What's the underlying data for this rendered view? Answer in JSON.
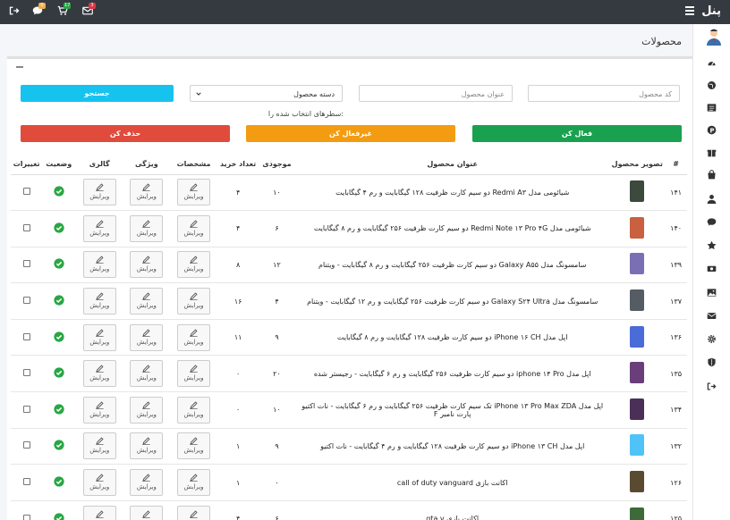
{
  "topbar": {
    "brand": "پنل",
    "badges": {
      "chat": "0",
      "cart": "17",
      "mail": "3"
    },
    "colors": {
      "chat": "#f0ad4e",
      "cart": "#28a745",
      "mail": "#dc3545"
    }
  },
  "page": {
    "title": "محصولات"
  },
  "filters": {
    "code_placeholder": "کد محصول",
    "title_placeholder": "عنوان محصول",
    "category_value": "دسته محصول",
    "search_label": "جستجو"
  },
  "bulk": {
    "note": "سطرهای انتخاب شده را:",
    "activate": "فعال کن",
    "deactivate": "غیرفعال کن",
    "delete": "حذف کن"
  },
  "table": {
    "headers": {
      "num": "#",
      "image": "تصویر محصول",
      "title": "عنوان محصول",
      "stock": "موجودی",
      "sold": "تعداد خرید",
      "specs": "مشخصات",
      "features": "ویژگی",
      "gallery": "گالری",
      "status": "وضعیت",
      "changes": "تغییرات"
    },
    "edit_label": "ویرایش",
    "rows": [
      {
        "num": "۱۴۱",
        "title": "شیائومی مدل Redmi A۳ دو سیم کارت ظرفیت ۱۲۸ گیگابایت و رم ۴ گیگابایت",
        "stock": "۱۰",
        "sold": "۴"
      },
      {
        "num": "۱۴۰",
        "title": "شیائومی مدل Redmi Note ۱۳ Pro ۴G دو سیم کارت ظرفیت ۲۵۶ گیگابایت و رم ۸ گیگابایت",
        "stock": "۶",
        "sold": "۴"
      },
      {
        "num": "۱۳۹",
        "title": "سامسونگ مدل Galaxy A۵۵ دو سیم کارت ظرفیت ۲۵۶ گیگابایت و رم ۸ گیگابایت - ویتنام",
        "stock": "۱۲",
        "sold": "۸"
      },
      {
        "num": "۱۳۷",
        "title": "سامسونگ مدل Galaxy S۲۴ Ultra دو سیم کارت ظرفیت ۲۵۶ گیگابایت و رم ۱۲ گیگابایت - ویتنام",
        "stock": "۴",
        "sold": "۱۶"
      },
      {
        "num": "۱۳۶",
        "title": "اپل مدل iPhone ۱۶ CH دو سیم کارت ظرفیت ۱۲۸ گیگابایت و رم ۸ گیگابایت",
        "stock": "۹",
        "sold": "۱۱"
      },
      {
        "num": "۱۳۵",
        "title": "اپل مدل iphone ۱۴ Pro دو سیم کارت ظرفیت ۲۵۶ گیگابایت و رم ۶ گیگابایت - رجیستر شده",
        "stock": "۲۰",
        "sold": "۰"
      },
      {
        "num": "۱۳۴",
        "title": "اپل مدل iPhone ۱۳ Pro Max ZDA تک سیم کارت ظرفیت ۲۵۶ گیگابایت و رم ۶ گیگابایت - نات اکتیو پارت نامبر F",
        "stock": "۱۰",
        "sold": "۰"
      },
      {
        "num": "۱۳۲",
        "title": "اپل مدل iPhone ۱۳ CH دو سیم کارت ظرفیت ۱۲۸ گیگابایت و رم ۴ گیگابایت - نات اکتیو",
        "stock": "۹",
        "sold": "۱"
      },
      {
        "num": "۱۲۶",
        "title": "اکانت بازی call of duty vanguard",
        "stock": "۰",
        "sold": "۱"
      },
      {
        "num": "۱۲۵",
        "title": "اکانت بازی gta v",
        "stock": "۶",
        "sold": "۴"
      }
    ]
  },
  "thumb_colors": [
    "#3b4a3c",
    "#c9603f",
    "#7b6fb3",
    "#555c63",
    "#4a6bd8",
    "#6a3e7a",
    "#4b2f58",
    "#4fc3f7",
    "#5a4a30",
    "#3e6a3a"
  ]
}
